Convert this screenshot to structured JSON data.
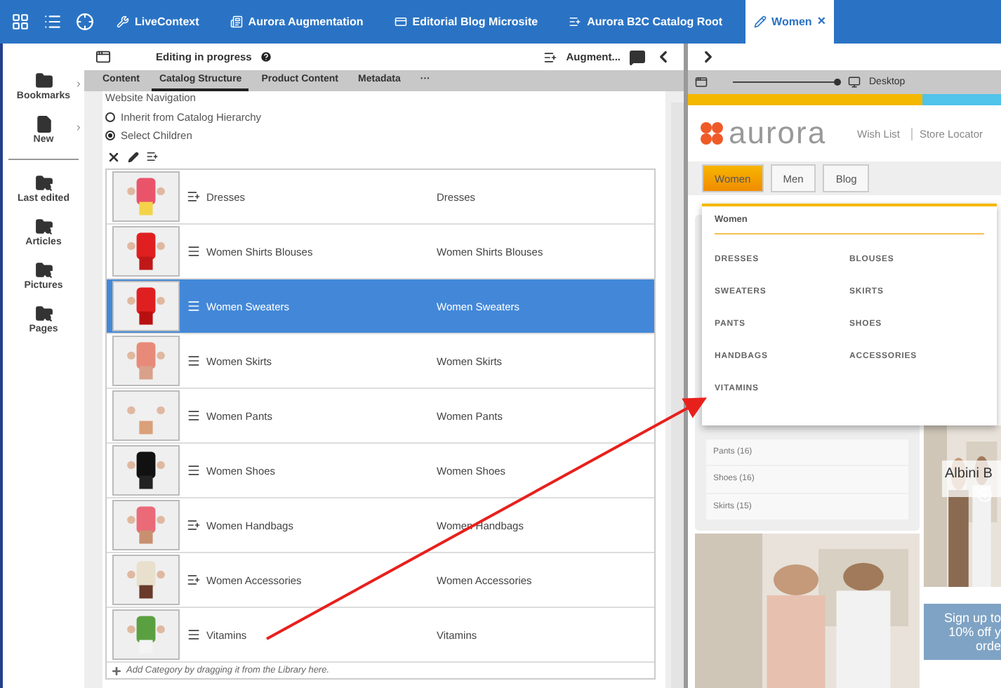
{
  "top_bar": {
    "tabs": [
      {
        "label": "LiveContext",
        "selected": false
      },
      {
        "label": "Aurora Augmentation",
        "selected": false
      },
      {
        "label": "Editorial Blog Microsite",
        "selected": false
      },
      {
        "label": "Aurora B2C Catalog Root",
        "selected": false
      },
      {
        "label": "Women",
        "selected": true
      }
    ],
    "close": "×"
  },
  "sidebar": {
    "items": [
      {
        "label": "Bookmarks",
        "kind": "menu"
      },
      {
        "label": "New",
        "kind": "menu"
      },
      {
        "label": "Last edited",
        "kind": "search"
      },
      {
        "label": "Articles",
        "kind": "search"
      },
      {
        "label": "Pictures",
        "kind": "search"
      },
      {
        "label": "Pages",
        "kind": "search"
      }
    ]
  },
  "toolbar": {
    "status": "Editing in progress",
    "augment": "Augment..."
  },
  "editor_tabs": {
    "tabs": [
      {
        "label": "Content",
        "selected": false
      },
      {
        "label": "Catalog Structure",
        "selected": true
      },
      {
        "label": "Product Content",
        "selected": false
      },
      {
        "label": "Metadata",
        "selected": false
      }
    ],
    "more": "···"
  },
  "navigation": {
    "heading": "Website Navigation",
    "options": [
      {
        "label": "Inherit from Catalog Hierarchy",
        "selected": false
      },
      {
        "label": "Select Children",
        "selected": true
      }
    ]
  },
  "children": {
    "rows": [
      {
        "name": "Dresses",
        "display": "Dresses",
        "kind": "augmented",
        "selected": false
      },
      {
        "name": "Women Shirts Blouses",
        "display": "Women Shirts Blouses",
        "kind": "plain",
        "selected": false
      },
      {
        "name": "Women Sweaters",
        "display": "Women Sweaters",
        "kind": "plain",
        "selected": true
      },
      {
        "name": "Women Skirts",
        "display": "Women Skirts",
        "kind": "plain",
        "selected": false
      },
      {
        "name": "Women Pants",
        "display": "Women Pants",
        "kind": "plain",
        "selected": false
      },
      {
        "name": "Women Shoes",
        "display": "Women Shoes",
        "kind": "plain",
        "selected": false
      },
      {
        "name": "Women Handbags",
        "display": "Women Handbags",
        "kind": "augmented",
        "selected": false
      },
      {
        "name": "Women Accessories",
        "display": "Women Accessories",
        "kind": "augmented",
        "selected": false
      },
      {
        "name": "Vitamins",
        "display": "Vitamins",
        "kind": "plain",
        "selected": false
      }
    ],
    "hint": "Add Category by dragging it from the Library here."
  },
  "preview": {
    "zoom": {
      "level": 0.97
    },
    "device": "Desktop",
    "logo": "aurora",
    "links": [
      "Wish List",
      "Store Locator"
    ],
    "nav": [
      {
        "label": "Women",
        "selected": true
      },
      {
        "label": "Men",
        "selected": false
      },
      {
        "label": "Blog",
        "selected": false
      }
    ],
    "menu": {
      "title": "Women",
      "items": [
        "DRESSES",
        "BLOUSES",
        "SWEATERS",
        "SKIRTS",
        "PANTS",
        "SHOES",
        "HANDBAGS",
        "ACCESSORIES",
        "VITAMINS"
      ]
    },
    "categories": [
      "Pants (16)",
      "Shoes (16)",
      "Skirts (15)"
    ],
    "teaser": "Albini B",
    "signup": [
      "Sign up to",
      "10% off y",
      "orde"
    ]
  }
}
